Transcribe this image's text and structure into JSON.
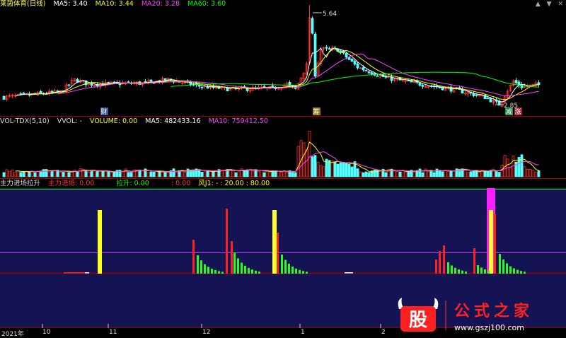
{
  "colors": {
    "up": "#ff3030",
    "down": "#54ffff",
    "ma5": "#ffffff",
    "ma10": "#ffff00",
    "ma20": "#ff40ff",
    "ma60": "#00ff00",
    "border": "#a00000",
    "subpanel_bg": "#141454",
    "yellow_bar": "#ffff20",
    "red_bar": "#ff2020",
    "green_bar": "#20ff20",
    "magenta_bar": "#ff20ff",
    "line_purple": "#c040ff"
  },
  "main_panel": {
    "stock_name": "莱茵体育(日线)",
    "ma5": {
      "label": "MA5:",
      "value": "3.40"
    },
    "ma10": {
      "label": "MA10:",
      "value": "3.44"
    },
    "ma20": {
      "label": "MA20:",
      "value": "3.28"
    },
    "ma60": {
      "label": "MA60:",
      "value": "3.60"
    },
    "high_label": "5.64",
    "low_label": "2.85",
    "markers": [
      "财",
      "筹",
      "减",
      "涨"
    ]
  },
  "volume_panel": {
    "title": "VOL-TDX(5,10)",
    "vvol": "VVOL: -",
    "volume": "VOLUME: 0.00",
    "ma5": "MA5: 482433.16",
    "ma10": "MA10: 759412.50"
  },
  "indicator_panel": {
    "title": "主力进场拉升",
    "main_entry": "主力进场: 0.00",
    "pull_up": "拉升: 0.00",
    "value3": ": 0.00",
    "wind": "风J1: - : 20.00 : 80.00"
  },
  "x_axis": {
    "labels": [
      "2021年",
      "10",
      "11",
      "12",
      "1",
      "2"
    ]
  },
  "watermark": {
    "icon_char": "股",
    "name": "公式之家",
    "url": "www.gszj100.com"
  }
}
